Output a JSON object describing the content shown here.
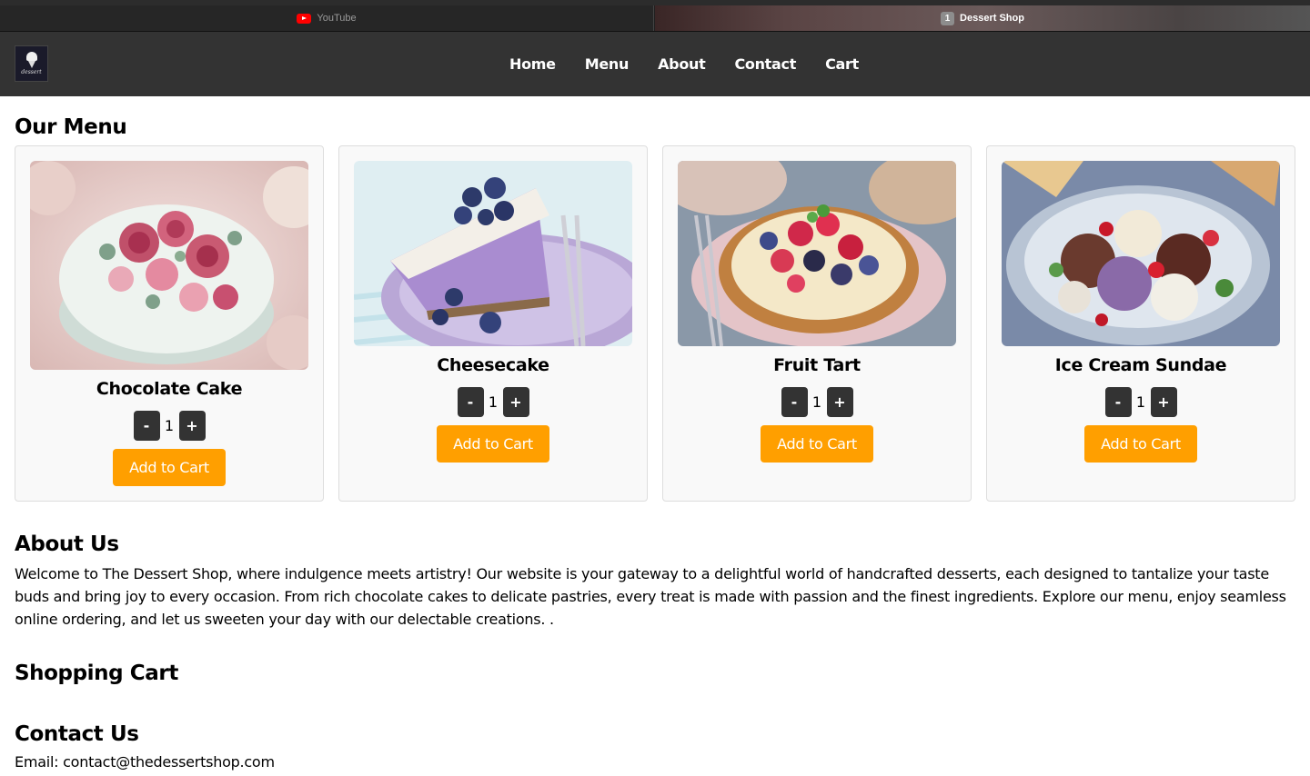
{
  "browser": {
    "tabs": [
      {
        "label": "YouTube",
        "icon": "youtube-icon"
      },
      {
        "label": "Dessert Shop",
        "badge": "1"
      }
    ]
  },
  "header": {
    "logo_text": "dessert",
    "nav": [
      "Home",
      "Menu",
      "About",
      "Contact",
      "Cart"
    ]
  },
  "menu": {
    "heading": "Our Menu",
    "items": [
      {
        "name": "Chocolate Cake",
        "quantity": "1",
        "minus": "-",
        "plus": "+",
        "button": "Add to Cart"
      },
      {
        "name": "Cheesecake",
        "quantity": "1",
        "minus": "-",
        "plus": "+",
        "button": "Add to Cart"
      },
      {
        "name": "Fruit Tart",
        "quantity": "1",
        "minus": "-",
        "plus": "+",
        "button": "Add to Cart"
      },
      {
        "name": "Ice Cream Sundae",
        "quantity": "1",
        "minus": "-",
        "plus": "+",
        "button": "Add to Cart"
      }
    ]
  },
  "about": {
    "heading": "About Us",
    "text": "Welcome to The Dessert Shop, where indulgence meets artistry! Our website is your gateway to a delightful world of handcrafted desserts, each designed to tantalize your taste buds and bring joy to every occasion. From rich chocolate cakes to delicate pastries, every treat is made with passion and the finest ingredients. Explore our menu, enjoy seamless online ordering, and let us sweeten your day with our delectable creations. ."
  },
  "cart": {
    "heading": "Shopping Cart"
  },
  "contact": {
    "heading": "Contact Us",
    "email": "Email: contact@thedessertshop.com"
  },
  "colors": {
    "header_bg": "#333333",
    "accent": "#ff9f00",
    "qty_button": "#333333",
    "card_bg": "#f9f9f9"
  }
}
